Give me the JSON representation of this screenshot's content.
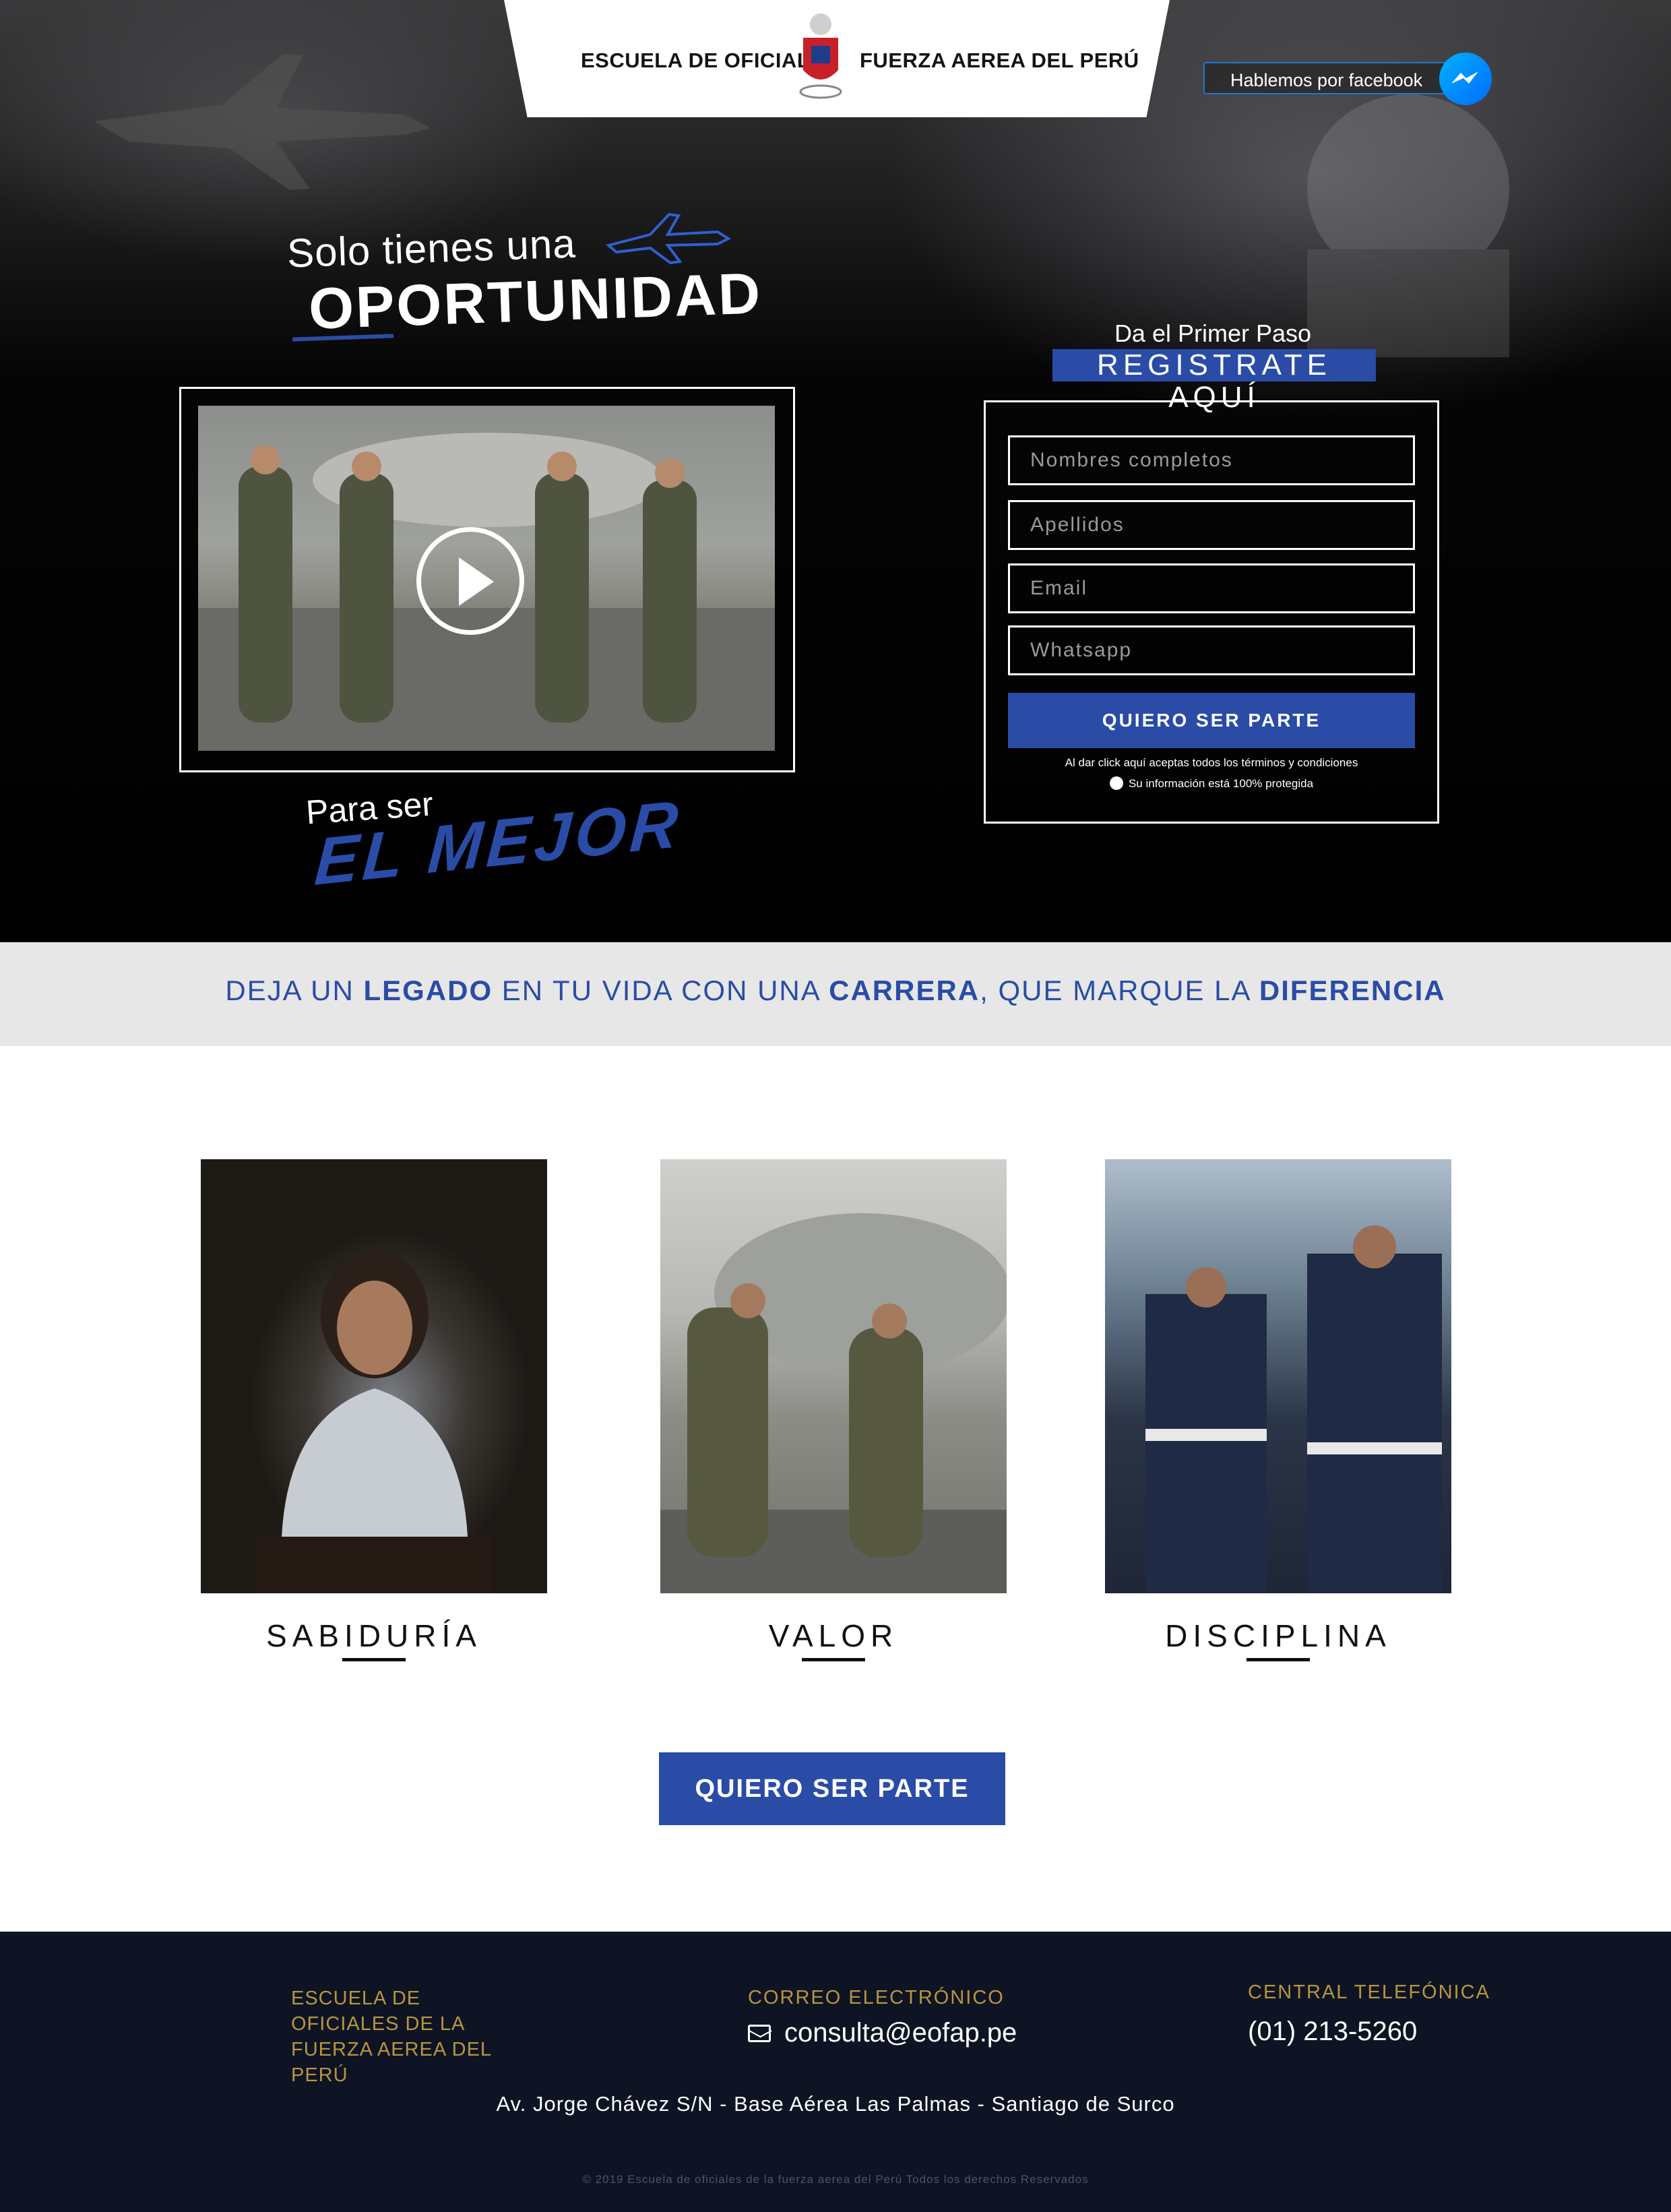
{
  "header": {
    "logo_left": "ESCUELA DE OFICIALES",
    "logo_right": "FUERZA AEREA DEL PERÚ",
    "facebook_button": "Hablemos por facebook"
  },
  "hero": {
    "headline_small": "Solo tienes una",
    "headline_big": "OPORTUNIDAD",
    "tagline_small": "Para ser",
    "tagline_big": "EL MEJOR"
  },
  "form": {
    "intro": "Da el Primer Paso",
    "title": "REGISTRATE AQUÍ",
    "fields": [
      {
        "placeholder": "Nombres completos"
      },
      {
        "placeholder": "Apellidos"
      },
      {
        "placeholder": "Email"
      },
      {
        "placeholder": "Whatsapp"
      }
    ],
    "submit_label": "QUIERO SER PARTE",
    "terms": "Al dar click aquí aceptas todos los términos y condiciones",
    "secure": "Su información está 100% protegida"
  },
  "band": {
    "parts": [
      "DEJA UN ",
      "LEGADO",
      " EN TU  VIDA CON UNA ",
      "CARRERA",
      ", QUE MARQUE LA ",
      "DIFERENCIA"
    ]
  },
  "values": [
    {
      "label": "SABIDURÍA"
    },
    {
      "label": "VALOR"
    },
    {
      "label": "DISCIPLINA"
    }
  ],
  "cta_label": "QUIERO SER PARTE",
  "footer": {
    "school": "ESCUELA DE OFICIALES DE LA FUERZA AEREA DEL PERÚ",
    "mail_label": "CORREO ELECTRÓNICO",
    "mail": "consulta@eofap.pe",
    "phone_label": "CENTRAL TELEFÓNICA",
    "phone": "(01) 213-5260",
    "address": "Av. Jorge Chávez S/N - Base Aérea Las Palmas - Santiago de Surco",
    "copyright": "© 2019 Escuela de oficiales de la fuerza aerea del Perú Todos los derechos Reservados"
  },
  "colors": {
    "accent_blue": "#2a4ca6",
    "footer_bg": "#0e1423",
    "footer_gold": "#b8963e",
    "band_bg": "#e7e7e7"
  },
  "icons": [
    "crest-logo-icon",
    "messenger-icon",
    "plane-icon",
    "play-icon",
    "lock-icon",
    "mail-icon"
  ]
}
